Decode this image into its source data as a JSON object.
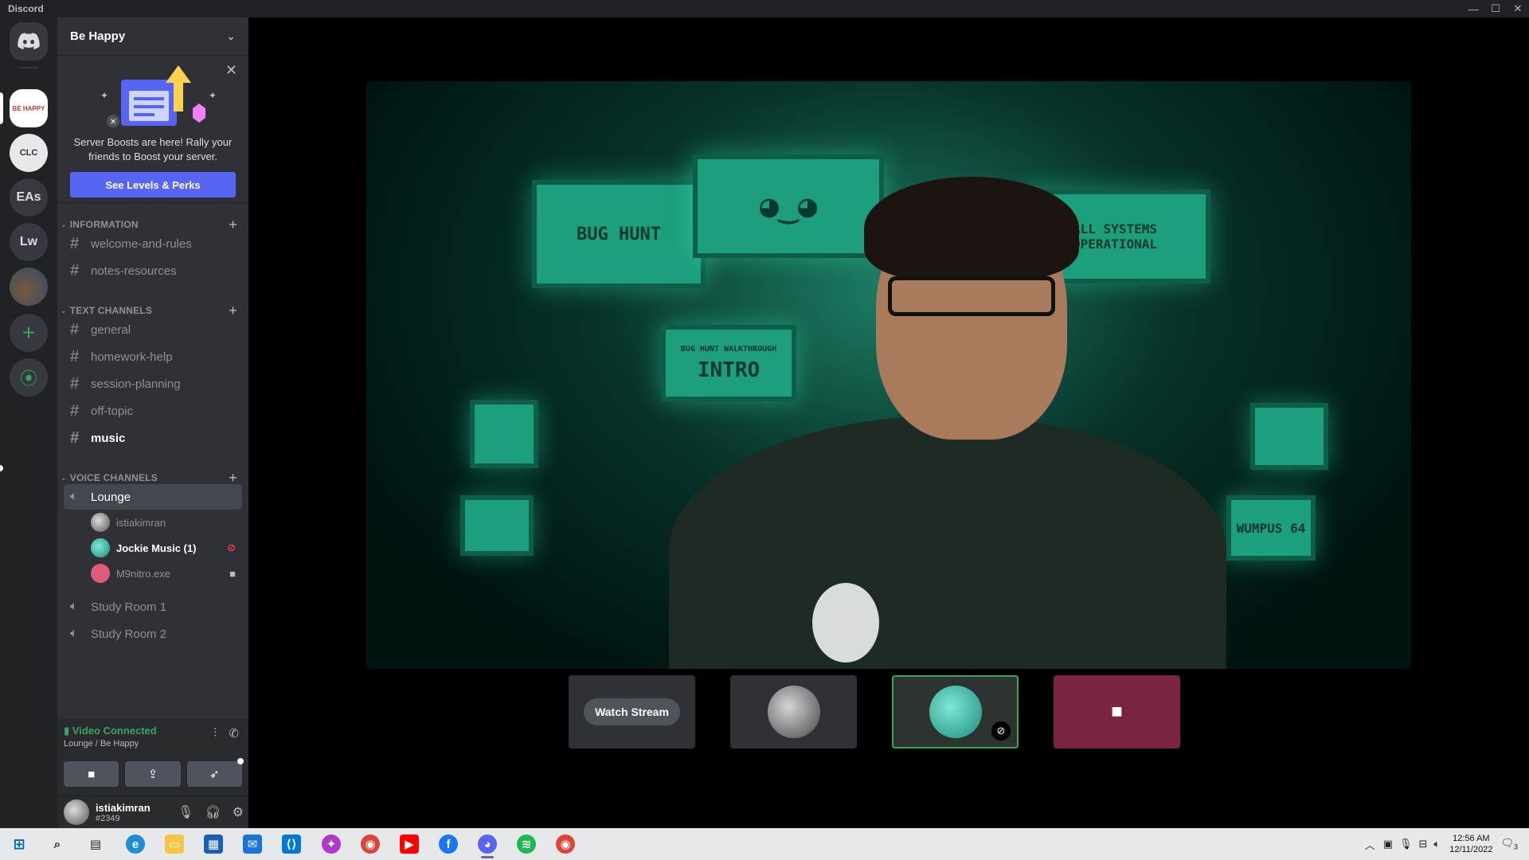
{
  "window": {
    "title": "Discord"
  },
  "rail": {
    "servers": [
      {
        "label": ""
      },
      {
        "label": "BE HAPPY"
      },
      {
        "label": "CLC"
      },
      {
        "label": "EAs"
      },
      {
        "label": "Lw"
      },
      {
        "label": ""
      }
    ],
    "add_symbol": "+",
    "explore_symbol": "⦿"
  },
  "server": {
    "name": "Be Happy"
  },
  "boost": {
    "text": "Server Boosts are here! Rally your friends to Boost your server.",
    "button": "See Levels & Perks"
  },
  "categories": {
    "information": "INFORMATION",
    "text": "TEXT CHANNELS",
    "voice": "VOICE CHANNELS"
  },
  "channels": {
    "information": [
      "welcome-and-rules",
      "notes-resources"
    ],
    "text": [
      "general",
      "homework-help",
      "session-planning",
      "off-topic",
      "music"
    ],
    "voice": [
      "Lounge",
      "Study Room 1",
      "Study Room 2"
    ]
  },
  "voice_users": [
    {
      "name": "istiakimran"
    },
    {
      "name": "Jockie Music (1)"
    },
    {
      "name": "M9nitro.exe"
    }
  ],
  "rtc": {
    "status": "Video Connected",
    "location": "Lounge / Be Happy"
  },
  "user": {
    "name": "istiakimran",
    "tag": "#2349"
  },
  "stage": {
    "watch_stream": "Watch Stream"
  },
  "video_screens": {
    "bug_hunt": "BUG HUNT",
    "systems": "ALL SYSTEMS OPERATIONAL",
    "walkthrough": "BUG HUNT WALKTHROUGH",
    "intro": "INTRO",
    "wumpus": "WUMPUS 64"
  },
  "tray": {
    "time": "12:56 AM",
    "date": "12/11/2022",
    "notifications": "3"
  },
  "colors": {
    "accent": "#5865f2",
    "connected": "#3ba55d",
    "muted": "#ed4245"
  }
}
